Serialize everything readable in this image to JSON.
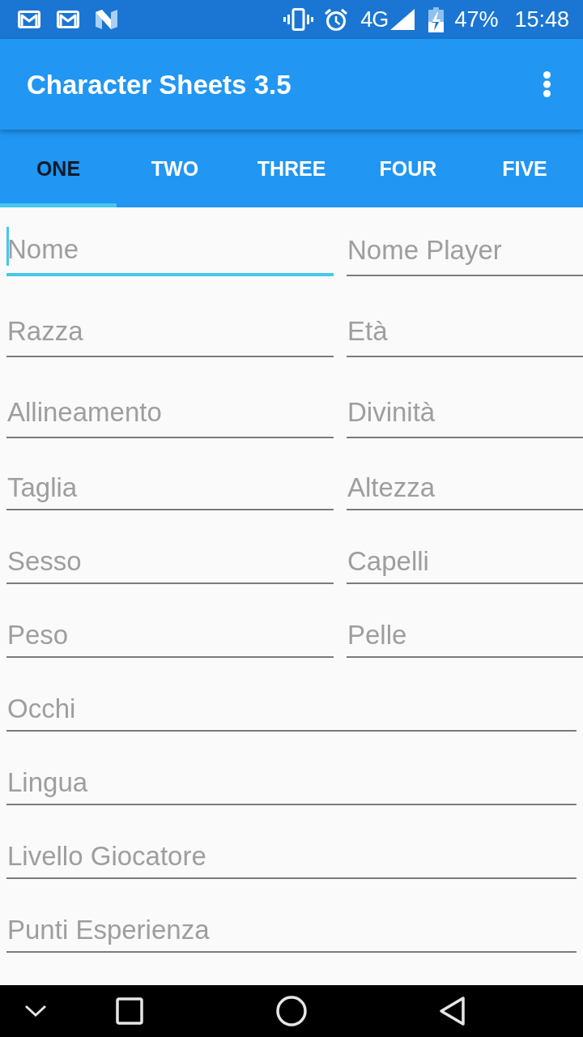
{
  "status_bar": {
    "network": "4G",
    "battery": "47%",
    "time": "15:48"
  },
  "app_bar": {
    "title": "Character Sheets 3.5"
  },
  "tabs": [
    {
      "label": "ONE",
      "selected": true
    },
    {
      "label": "TWO",
      "selected": false
    },
    {
      "label": "THREE",
      "selected": false
    },
    {
      "label": "FOUR",
      "selected": false
    },
    {
      "label": "FIVE",
      "selected": false
    }
  ],
  "form": {
    "rows": [
      {
        "fields": [
          {
            "placeholder": "Nome",
            "focused": true
          },
          {
            "placeholder": "Nome Player",
            "focused": false
          }
        ]
      },
      {
        "fields": [
          {
            "placeholder": "Razza",
            "focused": false
          },
          {
            "placeholder": "Età",
            "focused": false
          }
        ]
      },
      {
        "fields": [
          {
            "placeholder": "Allineamento",
            "focused": false
          },
          {
            "placeholder": "Divinità",
            "focused": false
          }
        ]
      },
      {
        "fields": [
          {
            "placeholder": "Taglia",
            "focused": false
          },
          {
            "placeholder": "Altezza",
            "focused": false
          }
        ]
      },
      {
        "fields": [
          {
            "placeholder": "Sesso",
            "focused": false
          },
          {
            "placeholder": "Capelli",
            "focused": false
          }
        ]
      },
      {
        "fields": [
          {
            "placeholder": "Peso",
            "focused": false
          },
          {
            "placeholder": "Pelle",
            "focused": false
          }
        ]
      },
      {
        "fields": [
          {
            "placeholder": "Occhi",
            "focused": false
          }
        ]
      },
      {
        "fields": [
          {
            "placeholder": "Lingua",
            "focused": false
          }
        ]
      },
      {
        "fields": [
          {
            "placeholder": "Livello Giocatore",
            "focused": false
          }
        ]
      },
      {
        "fields": [
          {
            "placeholder": "Punti Esperienza",
            "focused": false
          }
        ]
      }
    ]
  }
}
